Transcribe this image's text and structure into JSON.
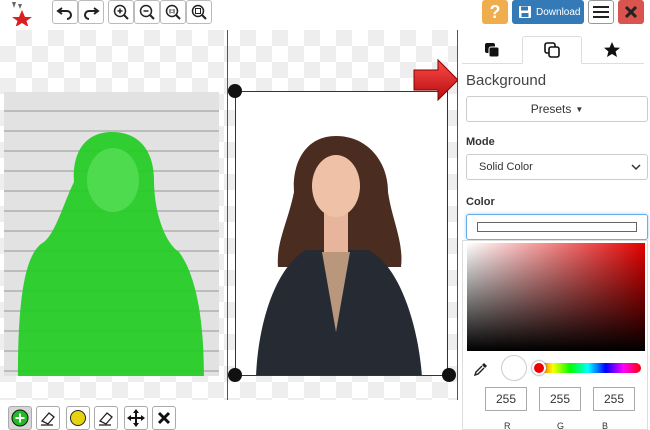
{
  "toolbar": {
    "download_label": "Download",
    "help_label": "?"
  },
  "panel": {
    "title": "Background",
    "presets_label": "Presets",
    "mode_label": "Mode",
    "mode_value": "Solid Color",
    "color_label": "Color",
    "rgb": {
      "r": "255",
      "g": "255",
      "b": "255",
      "r_label": "R",
      "g_label": "G",
      "b_label": "B"
    },
    "selected_color": "#ffffff",
    "active_tab": "background"
  },
  "colors": {
    "accent_blue": "#337ab7",
    "help_orange": "#f0ad4e",
    "close_red": "#d9534f",
    "keep_green": "#22cc22",
    "arrow_red": "#e01b1b"
  }
}
